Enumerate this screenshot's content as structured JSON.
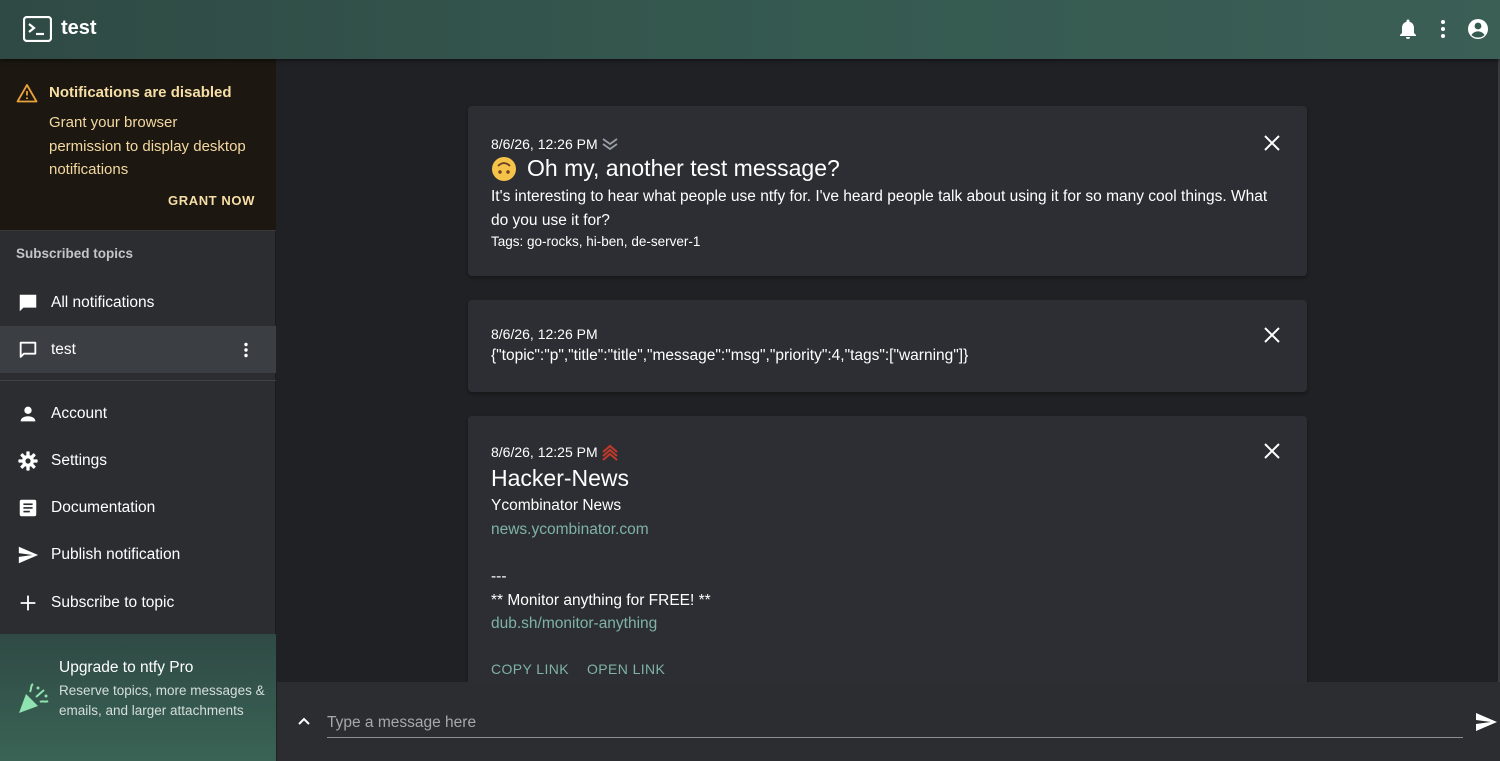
{
  "app": {
    "title": "test"
  },
  "notification_alert": {
    "title": "Notifications are disabled",
    "body": "Grant your browser permission to display desktop notifications",
    "grant_label": "GRANT NOW"
  },
  "sidebar": {
    "section_label": "Subscribed topics",
    "topics": [
      {
        "label": "All notifications",
        "icon": "chat-filled-icon"
      },
      {
        "label": "test",
        "icon": "chat-outline-icon",
        "selected": true
      }
    ],
    "menu": [
      {
        "label": "Account",
        "icon": "person-icon"
      },
      {
        "label": "Settings",
        "icon": "gear-icon"
      },
      {
        "label": "Documentation",
        "icon": "article-icon"
      },
      {
        "label": "Publish notification",
        "icon": "send-icon"
      },
      {
        "label": "Subscribe to topic",
        "icon": "plus-icon"
      }
    ],
    "upgrade": {
      "title": "Upgrade to ntfy Pro",
      "body": "Reserve topics, more messages & emails, and larger attachments"
    }
  },
  "messages": [
    {
      "date": "8/6/26, 12:26 PM",
      "priority_icon": "low-priority-chevrons-icon",
      "emoji_icon": "upside-down-face-icon",
      "title": "Oh my, another test message?",
      "body": "It's interesting to hear what people use ntfy for. I've heard people talk about using it for so many cool things. What do you use it for?",
      "tags": "Tags: go-rocks, hi-ben, de-server-1"
    },
    {
      "date": "8/6/26, 12:26 PM",
      "body": "{\"topic\":\"p\",\"title\":\"title\",\"message\":\"msg\",\"priority\":4,\"tags\":[\"warning\"]}"
    },
    {
      "date": "8/6/26, 12:25 PM",
      "priority_icon": "high-priority-chevrons-icon",
      "title": "Hacker-News",
      "line1": "Ycombinator News",
      "link1": "news.ycombinator.com",
      "separator": "---",
      "line2": "** Monitor anything for FREE! **",
      "link2": "dub.sh/monitor-anything",
      "actions": [
        "COPY LINK",
        "OPEN LINK"
      ]
    }
  ],
  "composer": {
    "placeholder": "Type a message here"
  },
  "colors": {
    "accent": "#7fb3a5",
    "appbar": "#355a50",
    "warning_text": "#f7dfa6",
    "high_priority": "#c0392b"
  }
}
